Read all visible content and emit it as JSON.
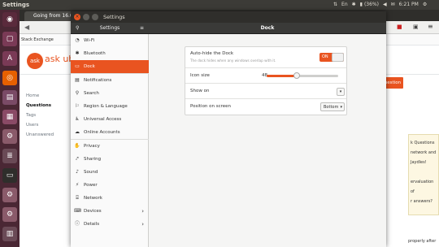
{
  "topbar": {
    "title": "Settings",
    "battery": "(36%)",
    "time": "6:21 PM"
  },
  "browser": {
    "tab_title": "Going from 16.04 to 18...",
    "stack_exchange": "Stack Exchange",
    "askubuntu": "ask ubuntu",
    "ask_question": "Ask Question",
    "left_nav": [
      "Home",
      "Questions",
      "Tags",
      "Users",
      "Unanswered"
    ],
    "right_snippets": [
      "k Questions",
      "network and",
      "Jaydles!",
      "ervaluation of",
      "r answers?"
    ],
    "bottom_snippet": "properly after"
  },
  "settings": {
    "window_title": "Settings",
    "header_left": "Settings",
    "header_title": "Dock",
    "sidebar": [
      {
        "label": "Wi-Fi",
        "icon": "wifi-icon",
        "glyph": "◔"
      },
      {
        "label": "Bluetooth",
        "icon": "bluetooth-icon",
        "glyph": "✱"
      },
      {
        "label": "Dock",
        "icon": "dock-icon",
        "glyph": "▭",
        "selected": true
      },
      {
        "label": "Notifications",
        "icon": "notifications-icon",
        "glyph": "▤"
      },
      {
        "label": "Search",
        "icon": "search-icon",
        "glyph": "⚲"
      },
      {
        "label": "Region & Language",
        "icon": "region-icon",
        "glyph": "⚐"
      },
      {
        "label": "Universal Access",
        "icon": "universal-access-icon",
        "glyph": "♿"
      },
      {
        "label": "Online Accounts",
        "icon": "online-accounts-icon",
        "glyph": "☁"
      },
      {
        "label": "Privacy",
        "icon": "privacy-icon",
        "glyph": "✋"
      },
      {
        "label": "Sharing",
        "icon": "sharing-icon",
        "glyph": "⤤"
      },
      {
        "label": "Sound",
        "icon": "sound-icon",
        "glyph": "♪"
      },
      {
        "label": "Power",
        "icon": "power-icon",
        "glyph": "⚡"
      },
      {
        "label": "Network",
        "icon": "network-icon",
        "glyph": "⌸"
      },
      {
        "label": "Devices",
        "icon": "devices-icon",
        "glyph": "⌨",
        "chevron": "›"
      },
      {
        "label": "Details",
        "icon": "details-icon",
        "glyph": "ⓘ",
        "chevron": "›"
      }
    ],
    "dock": {
      "autohide_label": "Auto-hide the Dock",
      "autohide_desc": "The dock hides when any windows overlap with it.",
      "autohide_state": "ON",
      "icon_size_label": "Icon size",
      "icon_size_value": "48",
      "icon_size_fraction": 0.42,
      "show_on_label": "Show on",
      "show_on_value": "",
      "position_label": "Position on screen",
      "position_value": "Bottom"
    },
    "accent": "#e95420"
  }
}
